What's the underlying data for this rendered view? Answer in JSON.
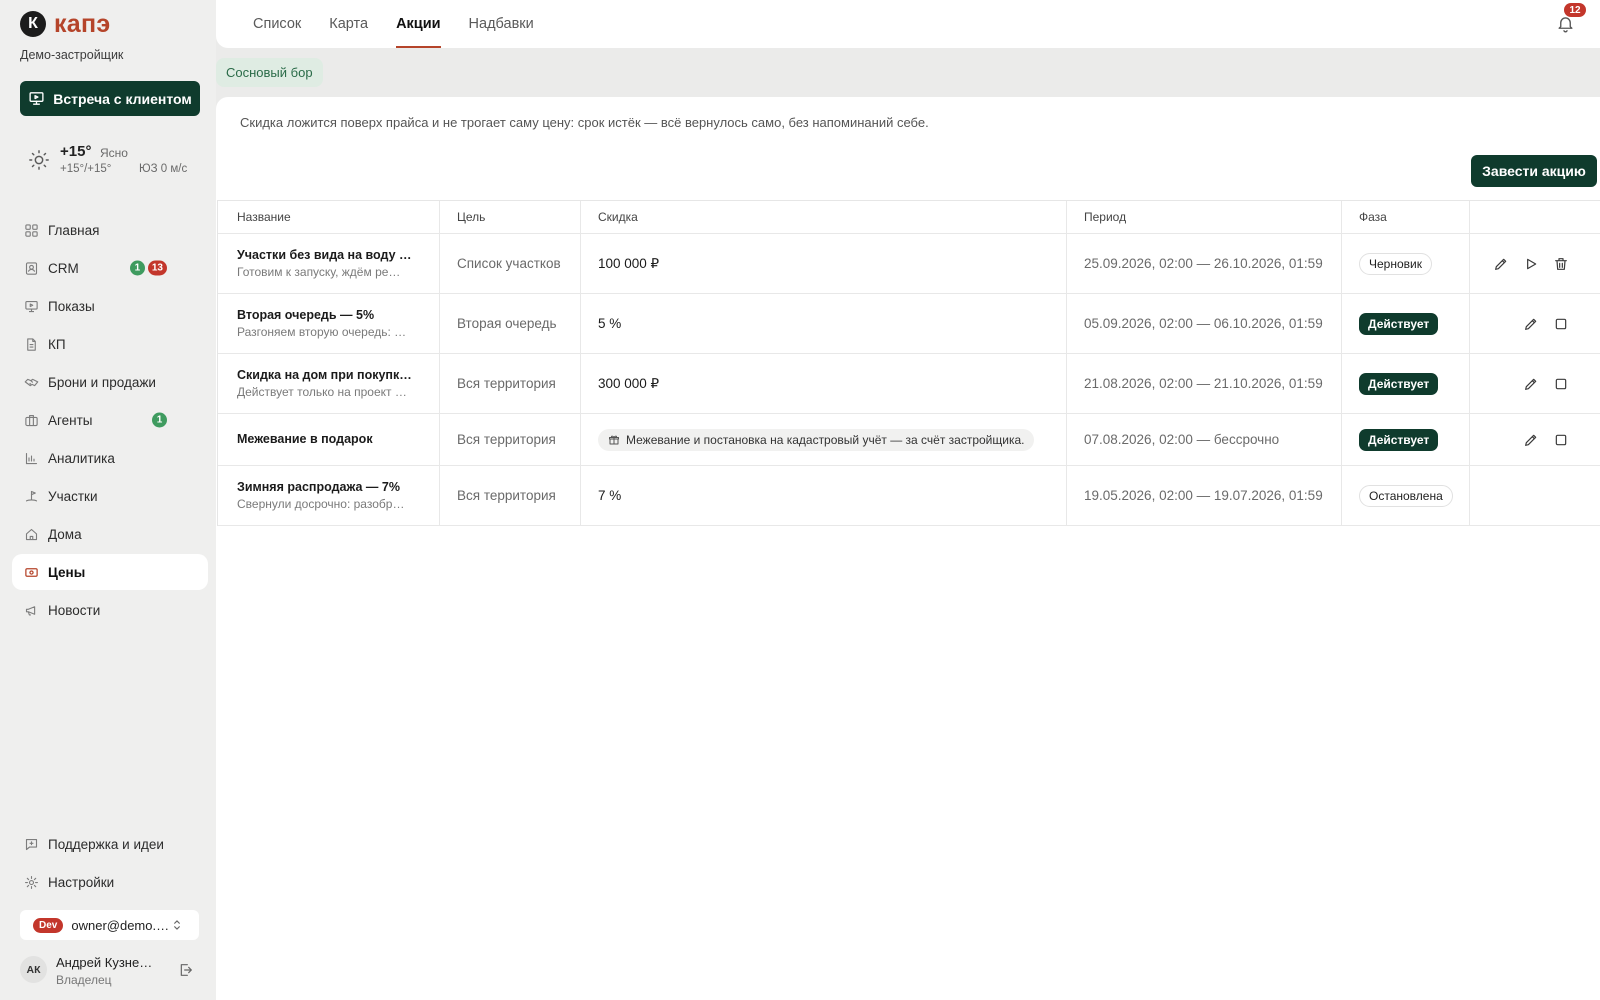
{
  "brand": {
    "logo_letter": "К",
    "logo_text": "капэ",
    "org": "Демо-застройщик",
    "accent_color": "#b5442a",
    "primary_color": "#0f3b2d"
  },
  "sidebar": {
    "meeting_button": {
      "label": "Встреча с клиентом",
      "icon": "presentation-icon"
    },
    "weather": {
      "temp": "+15°",
      "condition": "Ясно",
      "range": "+15°/+15°",
      "wind": "ЮЗ 0 м/с",
      "icon": "sun-icon"
    },
    "nav": [
      {
        "label": "Главная",
        "icon": "grid-icon"
      },
      {
        "label": "CRM",
        "icon": "contacts-icon",
        "badges": [
          "1",
          "13"
        ]
      },
      {
        "label": "Показы",
        "icon": "presentation-icon"
      },
      {
        "label": "КП",
        "icon": "document-icon"
      },
      {
        "label": "Брони и продажи",
        "icon": "handshake-icon"
      },
      {
        "label": "Агенты",
        "icon": "briefcase-icon",
        "badges": [
          "1"
        ]
      },
      {
        "label": "Аналитика",
        "icon": "bar-chart-icon"
      },
      {
        "label": "Участки",
        "icon": "plot-flag-icon"
      },
      {
        "label": "Дома",
        "icon": "house-icon"
      },
      {
        "label": "Цены",
        "icon": "banknote-icon",
        "active": true
      },
      {
        "label": "Новости",
        "icon": "megaphone-icon"
      }
    ],
    "footer_nav": [
      {
        "label": "Поддержка и идеи",
        "icon": "message-plus-icon"
      },
      {
        "label": "Настройки",
        "icon": "gear-icon"
      }
    ],
    "environment": {
      "badge": "Dev",
      "account": "owner@demo.…",
      "icon": "chevron-up-down-icon"
    },
    "user": {
      "initials": "АК",
      "name": "Андрей Кузне…",
      "role": "Владелец",
      "logout_icon": "logout-icon"
    }
  },
  "header": {
    "tabs": [
      {
        "label": "Список"
      },
      {
        "label": "Карта"
      },
      {
        "label": "Акции",
        "active": true
      },
      {
        "label": "Надбавки"
      }
    ],
    "notifications": {
      "icon": "bell-icon",
      "count": "12"
    }
  },
  "filter": {
    "project_chip": "Сосновый бор"
  },
  "promotions": {
    "description": "Скидка ложится поверх прайса и не трогает саму цену: срок истёк — всё вернулось само, без напоминаний себе.",
    "create_button": "Завести акцию",
    "columns": [
      "Название",
      "Цель",
      "Скидка",
      "Период",
      "Фаза"
    ],
    "rows": [
      {
        "name": "Участки без вида на воду …",
        "note": "Готовим к запуску, ждём ре…",
        "target": "Список участков",
        "discount": "100 000 ₽",
        "period": "25.09.2026, 02:00 — 26.10.2026, 01:59",
        "phase": "Черновик",
        "actions": [
          "edit-icon",
          "play-icon",
          "delete-icon"
        ]
      },
      {
        "name": "Вторая очередь — 5%",
        "note": "Разгоняем вторую очередь: …",
        "target": "Вторая очередь",
        "discount": "5 %",
        "period": "05.09.2026, 02:00 — 06.10.2026, 01:59",
        "phase": "Действует",
        "actions": [
          "edit-icon",
          "stop-icon"
        ]
      },
      {
        "name": "Скидка на дом при покупк…",
        "note": "Действует только на проект …",
        "target": "Вся территория",
        "discount": "300 000 ₽",
        "period": "21.08.2026, 02:00 — 21.10.2026, 01:59",
        "phase": "Действует",
        "actions": [
          "edit-icon",
          "stop-icon"
        ]
      },
      {
        "name": "Межевание в подарок",
        "target": "Вся территория",
        "discount": "Межевание и постановка на кадастровый учёт — за счёт застройщика.",
        "discount_icon": "gift-icon",
        "period": "07.08.2026, 02:00 — бессрочно",
        "phase": "Действует",
        "actions": [
          "edit-icon",
          "stop-icon"
        ]
      },
      {
        "name": "Зимняя распродажа — 7%",
        "note": "Свернули досрочно: разобр…",
        "target": "Вся территория",
        "discount": "7 %",
        "period": "19.05.2026, 02:00 — 19.07.2026, 01:59",
        "phase": "Остановлена",
        "actions": []
      }
    ]
  }
}
